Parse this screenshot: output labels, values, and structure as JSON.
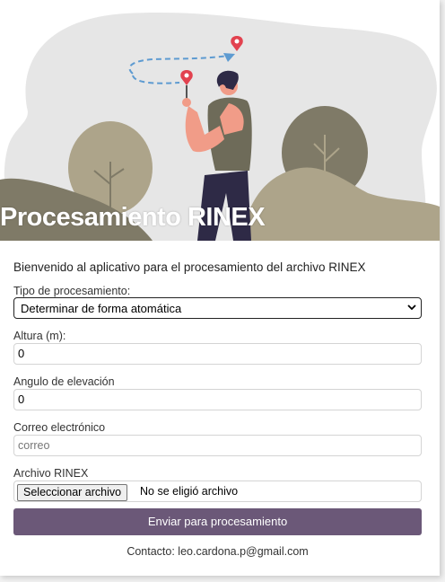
{
  "header": {
    "title": "Procesamiento RINEX"
  },
  "form": {
    "welcome": "Bienvenido al aplicativo para el procesamiento del archivo RINEX",
    "processing_type": {
      "label": "Tipo de procesamiento:",
      "selected": "Determinar de forma atomática"
    },
    "height": {
      "label": "Altura (m):",
      "value": "0"
    },
    "elevation": {
      "label": "Angulo de elevación",
      "value": "0"
    },
    "email": {
      "label": "Correo electrónico",
      "placeholder": "correo"
    },
    "file": {
      "label": "Archivo RINEX",
      "button": "Seleccionar archivo",
      "status": "No se eligió archivo"
    },
    "submit": "Enviar para procesamiento"
  },
  "footer": {
    "contact": "Contacto: leo.cardona.p@gmail.com"
  },
  "colors": {
    "accent": "#6b5878",
    "hero_bg": "#e6e6e6",
    "foliage": "#ada48a",
    "foliage_dark": "#7f7a67",
    "shirt": "#6e6b59",
    "skin": "#f19c88",
    "pin": "#e2424f",
    "path": "#5e9bd1"
  }
}
